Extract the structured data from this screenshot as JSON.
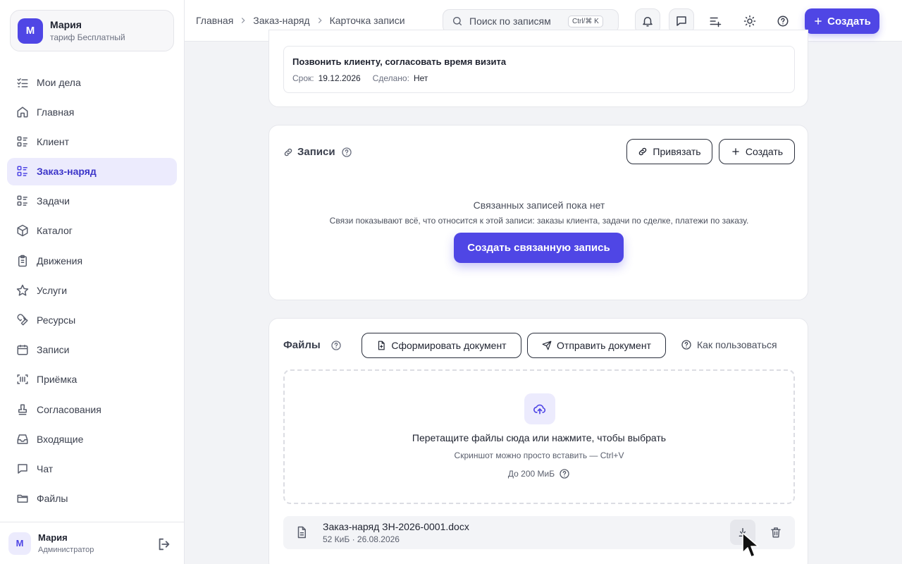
{
  "sidebar": {
    "profile": {
      "initial": "М",
      "name": "Мария",
      "plan": "тариф Бесплатный"
    },
    "items": [
      {
        "label": "Мои дела",
        "icon": "list-check-icon"
      },
      {
        "label": "Главная",
        "icon": "home-icon"
      },
      {
        "label": "Клиент",
        "icon": "list-icon"
      },
      {
        "label": "Заказ-наряд",
        "icon": "list-icon",
        "active": true
      },
      {
        "label": "Задачи",
        "icon": "list-icon"
      },
      {
        "label": "Каталог",
        "icon": "box-icon"
      },
      {
        "label": "Движения",
        "icon": "clipboard-icon"
      },
      {
        "label": "Услуги",
        "icon": "star-icon"
      },
      {
        "label": "Ресурсы",
        "icon": "wrench-icon"
      },
      {
        "label": "Записи",
        "icon": "calendar-icon"
      },
      {
        "label": "Приёмка",
        "icon": "barcode-icon"
      },
      {
        "label": "Согласования",
        "icon": "stamp-icon"
      },
      {
        "label": "Входящие",
        "icon": "inbox-icon"
      },
      {
        "label": "Чат",
        "icon": "chat-icon"
      },
      {
        "label": "Файлы",
        "icon": "folder-icon"
      }
    ],
    "footer": {
      "initial": "М",
      "name": "Мария",
      "role": "Администратор"
    }
  },
  "topbar": {
    "breadcrumb": [
      "Главная",
      "Заказ-наряд",
      "Карточка записи"
    ],
    "search_placeholder": "Поиск по записям",
    "search_shortcut": "Ctrl/⌘ K",
    "create_label": "Создать"
  },
  "task": {
    "title": "Позвонить клиенту, согласовать время визита",
    "due_label": "Срок:",
    "due_value": "19.12.2026",
    "done_label": "Сделано:",
    "done_value": "Нет"
  },
  "records": {
    "title": "Записи",
    "link_button": "Привязать",
    "create_button": "Создать",
    "empty_title": "Связанных записей пока нет",
    "empty_desc": "Связи показывают всё, что относится к этой записи: заказы клиента, задачи по сделке, платежи по заказу.",
    "create_related_button": "Создать связанную запись"
  },
  "files": {
    "title": "Файлы",
    "generate_button": "Сформировать документ",
    "send_button": "Отправить документ",
    "how_to_link": "Как пользоваться",
    "drop_title": "Перетащите файлы сюда или нажмите, чтобы выбрать",
    "drop_sub": "Скриншот можно просто вставить — Ctrl+V",
    "drop_limit": "До 200 МиБ",
    "items": [
      {
        "name": "Заказ-наряд ЗН-2026-0001.docx",
        "meta": "52 КиБ · 26.08.2026"
      }
    ]
  },
  "colors": {
    "accent": "#4f46e5",
    "active_bg": "#ecebfd",
    "page_bg": "#f2f3f6"
  }
}
